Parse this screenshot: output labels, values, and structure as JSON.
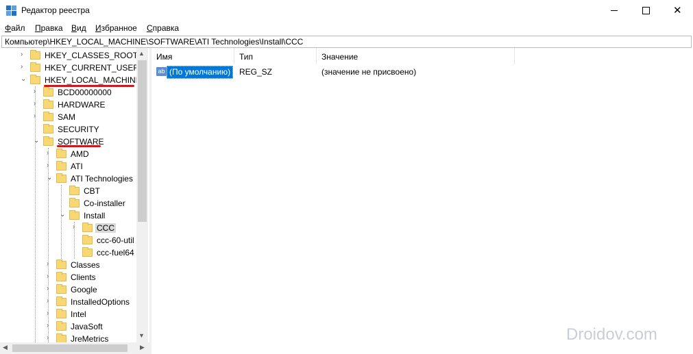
{
  "window": {
    "title": "Редактор реестра",
    "controls": {
      "minimize": "—",
      "maximize": "☐",
      "close": "✕"
    }
  },
  "menu": [
    {
      "label": "Файл",
      "mnemonic": "Ф",
      "rest": "айл"
    },
    {
      "label": "Правка",
      "mnemonic": "П",
      "rest": "равка"
    },
    {
      "label": "Вид",
      "mnemonic": "В",
      "rest": "ид"
    },
    {
      "label": "Избранное",
      "mnemonic": "И",
      "rest": "збранное"
    },
    {
      "label": "Справка",
      "mnemonic": "С",
      "rest": "правка"
    }
  ],
  "address": "Компьютер\\HKEY_LOCAL_MACHINE\\SOFTWARE\\ATI Technologies\\Install\\CCC",
  "tree": {
    "items": [
      {
        "label": "HKEY_CLASSES_ROOT",
        "expander": ">",
        "selected": false
      },
      {
        "label": "HKEY_CURRENT_USER",
        "expander": ">",
        "selected": false
      },
      {
        "label": "HKEY_LOCAL_MACHINE",
        "expander": "v",
        "selected": false
      },
      {
        "label": "BCD00000000",
        "expander": ">",
        "selected": false
      },
      {
        "label": "HARDWARE",
        "expander": ">",
        "selected": false
      },
      {
        "label": "SAM",
        "expander": ">",
        "selected": false
      },
      {
        "label": "SECURITY",
        "expander": "",
        "selected": false
      },
      {
        "label": "SOFTWARE",
        "expander": "v",
        "selected": false
      },
      {
        "label": "AMD",
        "expander": ">",
        "selected": false
      },
      {
        "label": "ATI",
        "expander": ">",
        "selected": false
      },
      {
        "label": "ATI Technologies",
        "expander": "v",
        "selected": false
      },
      {
        "label": "CBT",
        "expander": "",
        "selected": false
      },
      {
        "label": "Co-installer",
        "expander": "",
        "selected": false
      },
      {
        "label": "Install",
        "expander": "v",
        "selected": false
      },
      {
        "label": "CCC",
        "expander": ">",
        "selected": true
      },
      {
        "label": "ccc-60-util",
        "expander": "",
        "selected": false
      },
      {
        "label": "ccc-fuel64",
        "expander": "",
        "selected": false
      },
      {
        "label": "Classes",
        "expander": ">",
        "selected": false
      },
      {
        "label": "Clients",
        "expander": ">",
        "selected": false
      },
      {
        "label": "Google",
        "expander": ">",
        "selected": false
      },
      {
        "label": "InstalledOptions",
        "expander": ">",
        "selected": false
      },
      {
        "label": "Intel",
        "expander": ">",
        "selected": false
      },
      {
        "label": "JavaSoft",
        "expander": ">",
        "selected": false
      },
      {
        "label": "JreMetrics",
        "expander": ">",
        "selected": false
      }
    ]
  },
  "list": {
    "columns": [
      "Имя",
      "Тип",
      "Значение"
    ],
    "rows": [
      {
        "icon": "ab",
        "name": "(По умолчанию)",
        "type": "REG_SZ",
        "value": "(значение не присвоено)"
      }
    ]
  },
  "annotation_color": "#e0101a",
  "selection_color": "#0078d7",
  "watermark": "Droidov.com"
}
